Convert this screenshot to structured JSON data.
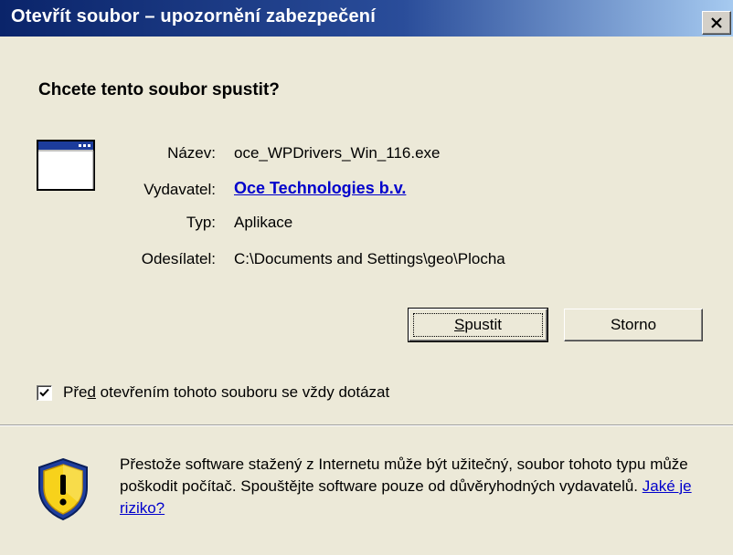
{
  "window": {
    "title": "Otevřít soubor – upozornění zabezpečení",
    "close_symbol": "✕"
  },
  "heading": "Chcete tento soubor spustit?",
  "file_info": {
    "name_label": "Název:",
    "name_value": "oce_WPDrivers_Win_116.exe",
    "publisher_label": "Vydavatel:",
    "publisher_value": "Oce Technologies b.v.",
    "type_label": "Typ:",
    "type_value": "Aplikace",
    "from_label": "Odesílatel:",
    "from_value": "C:\\Documents and Settings\\geo\\Plocha"
  },
  "buttons": {
    "run_label": "Spustit",
    "cancel_label": "Storno"
  },
  "checkbox": {
    "checked": true,
    "label_before": "Pře",
    "label_accel": "d",
    "label_after": " otevřením tohoto souboru se vždy dotázat"
  },
  "warning": {
    "text": "Přestože software stažený z Internetu může být užitečný, soubor tohoto typu může poškodit počítač. Spouštějte software pouze od důvěryhodných vydavatelů. ",
    "link_label": "Jaké je riziko?"
  },
  "icons": {
    "app": "application-window-icon",
    "warning": "security-shield-warning-icon",
    "close": "close-icon",
    "check": "checkmark-icon"
  },
  "colors": {
    "title_gradient_start": "#0a246a",
    "title_gradient_end": "#a6caf0",
    "link": "#0000cc",
    "dialog_bg": "#ece9d8"
  }
}
